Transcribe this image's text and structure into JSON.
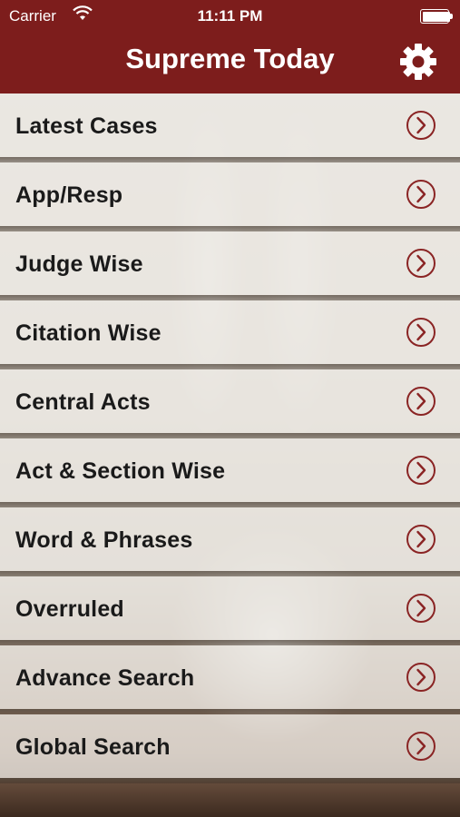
{
  "status_bar": {
    "carrier": "Carrier",
    "time": "11:11 PM",
    "battery_level": 1.0
  },
  "nav": {
    "title": "Supreme Today",
    "settings_icon": "gear-icon"
  },
  "colors": {
    "nav_background": "#7d1d1c",
    "chevron_color": "#8a2424"
  },
  "menu": {
    "items": [
      {
        "label": "Latest Cases"
      },
      {
        "label": "App/Resp"
      },
      {
        "label": "Judge Wise"
      },
      {
        "label": "Citation Wise"
      },
      {
        "label": "Central Acts"
      },
      {
        "label": "Act & Section Wise"
      },
      {
        "label": "Word & Phrases"
      },
      {
        "label": "Overruled"
      },
      {
        "label": "Advance Search"
      },
      {
        "label": "Global Search"
      }
    ]
  }
}
